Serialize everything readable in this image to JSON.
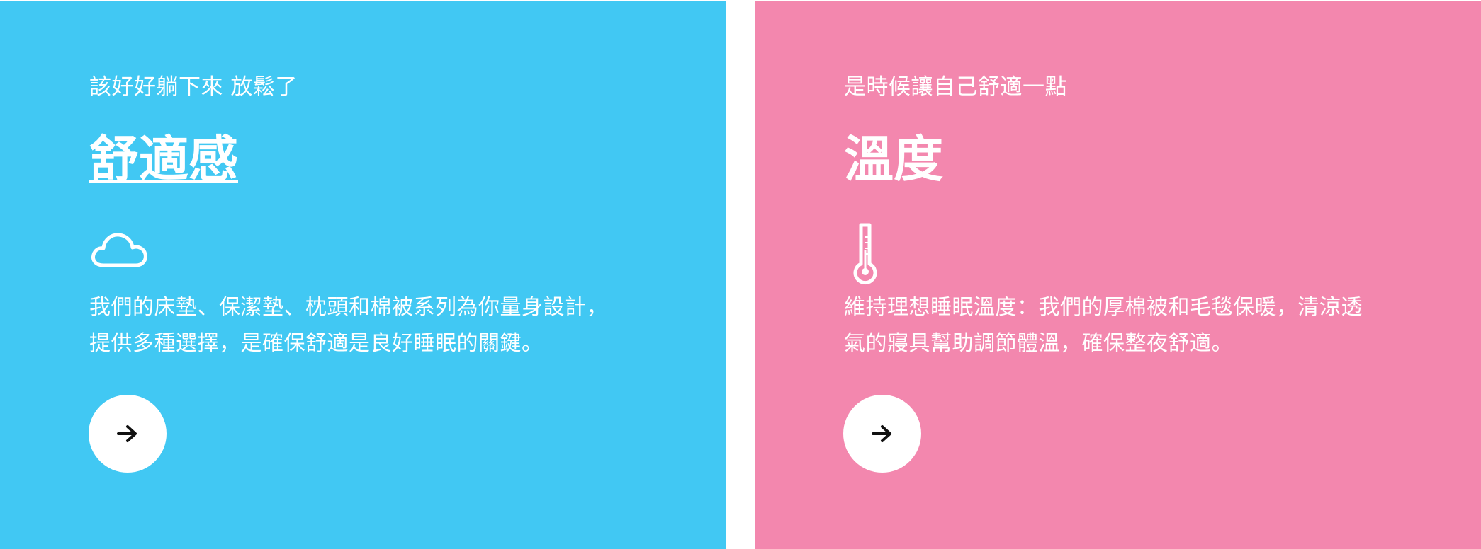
{
  "cards": [
    {
      "eyebrow": "該好好躺下來 放鬆了",
      "title": "舒適感",
      "icon": "cloud-icon",
      "desc_lines": [
        "我們的床墊、保潔墊、枕頭和棉被系列為你量身設計，",
        "提供多種選擇，是確保舒適是良好睡眠的關鍵。"
      ],
      "button_icon": "arrow-right-icon",
      "background": "#41c8f3"
    },
    {
      "eyebrow": "是時候讓自己舒適一點",
      "title": "溫度",
      "icon": "thermometer-icon",
      "desc_lines": [
        "維持理想睡眠溫度：我們的厚棉被和毛毯保暖，清涼透",
        "氣的寢具幫助調節體溫，確保整夜舒適。"
      ],
      "button_icon": "arrow-right-icon",
      "background": "#f387ae"
    }
  ]
}
